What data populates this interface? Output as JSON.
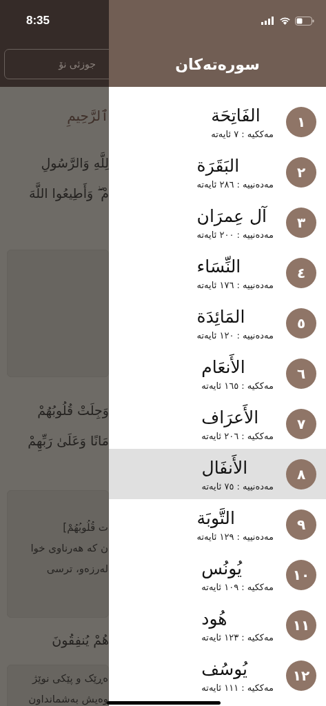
{
  "status_bar": {
    "time": "8:35"
  },
  "background_page": {
    "part_button": "جوزئی نۆ",
    "blocks": [
      {
        "kind": "heading",
        "lines": [
          "ٱلرَّحِيمِ"
        ]
      },
      {
        "kind": "verse",
        "lines": [
          "لِلَّهِ وَالرَّسُولِ",
          "مْ ۖ وَأَطِيعُوا اللَّهَ"
        ]
      },
      {
        "kind": "card"
      },
      {
        "kind": "verse",
        "lines": [
          "وَجِلَتْ قُلُوبُهُمْ",
          "مَانًا وَعَلَىٰ رَبِّهِمْ"
        ]
      },
      {
        "kind": "card",
        "lines": [
          "ت قُلُوبُهُمْ]",
          "ن كه هەرناوی خوا",
          "لەرزەو، ترسی"
        ]
      },
      {
        "kind": "verse",
        "lines": [
          "هُمْ يُنفِقُونَ"
        ]
      },
      {
        "kind": "card",
        "lines": [
          "ەڕێک و پێکی نوێژ",
          "وەیش بەشمانداون"
        ]
      }
    ]
  },
  "drawer": {
    "title": "سورەتەکان",
    "surahs": [
      {
        "number": "١",
        "name": "الفَاتِحَة",
        "info": "مەککیە : ٧ ئایەتە",
        "selected": false
      },
      {
        "number": "٢",
        "name": "البَقَرَة",
        "info": "مەدەنییە : ٢٨٦ ئایەتە",
        "selected": false
      },
      {
        "number": "٣",
        "name": "آل عِمرَان",
        "info": "مەدەنییە : ٢٠٠ ئایەتە",
        "selected": false
      },
      {
        "number": "٤",
        "name": "النِّسَاء",
        "info": "مەدەنییە : ١٧٦ ئایەتە",
        "selected": false
      },
      {
        "number": "٥",
        "name": "المَائِدَة",
        "info": "مەدەنییە : ١٢٠ ئایەتە",
        "selected": false
      },
      {
        "number": "٦",
        "name": "الأَنعَام",
        "info": "مەککیە : ١٦٥ ئایەتە",
        "selected": false
      },
      {
        "number": "٧",
        "name": "الأَعرَاف",
        "info": "مەککیە : ٢٠٦ ئایەتە",
        "selected": false
      },
      {
        "number": "٨",
        "name": "الأَنفَال",
        "info": "مەدەنییە : ٧٥ ئایەتە",
        "selected": true
      },
      {
        "number": "٩",
        "name": "التَّوبَة",
        "info": "مەدەنییە : ١٢٩ ئایەتە",
        "selected": false
      },
      {
        "number": "١٠",
        "name": "يُونُس",
        "info": "مەککیە : ١٠٩ ئایەتە",
        "selected": false
      },
      {
        "number": "١١",
        "name": "هُود",
        "info": "مەککیە : ١٢٣ ئایەتە",
        "selected": false
      },
      {
        "number": "١٢",
        "name": "يُوسُف",
        "info": "مەککیە : ١١١ ئایەتە",
        "selected": false
      }
    ]
  }
}
